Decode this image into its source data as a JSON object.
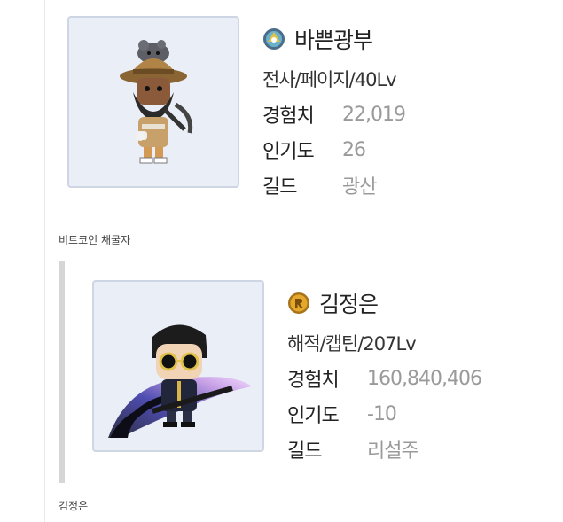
{
  "characters": [
    {
      "world_icon": "scania-world-icon",
      "name": "바쁜광부",
      "class_level": "전사/페이지/40Lv",
      "stats": [
        {
          "label": "경험치",
          "value": "22,019"
        },
        {
          "label": "인기도",
          "value": "26"
        },
        {
          "label": "길드",
          "value": "광산"
        }
      ],
      "caption": "비트코인 채굴자"
    },
    {
      "world_icon": "reboot-world-icon",
      "name": "김정은",
      "class_level": "해적/캡틴/207Lv",
      "stats": [
        {
          "label": "경험치",
          "value": "160,840,406"
        },
        {
          "label": "인기도",
          "value": "-10"
        },
        {
          "label": "길드",
          "value": "리설주"
        }
      ],
      "caption": "김정은"
    }
  ],
  "colors": {
    "portrait_bg": "#e9eef7",
    "portrait_border": "#cfd6e3",
    "value_text": "#9a9a9a",
    "quote_bar": "#d6d6d6"
  }
}
